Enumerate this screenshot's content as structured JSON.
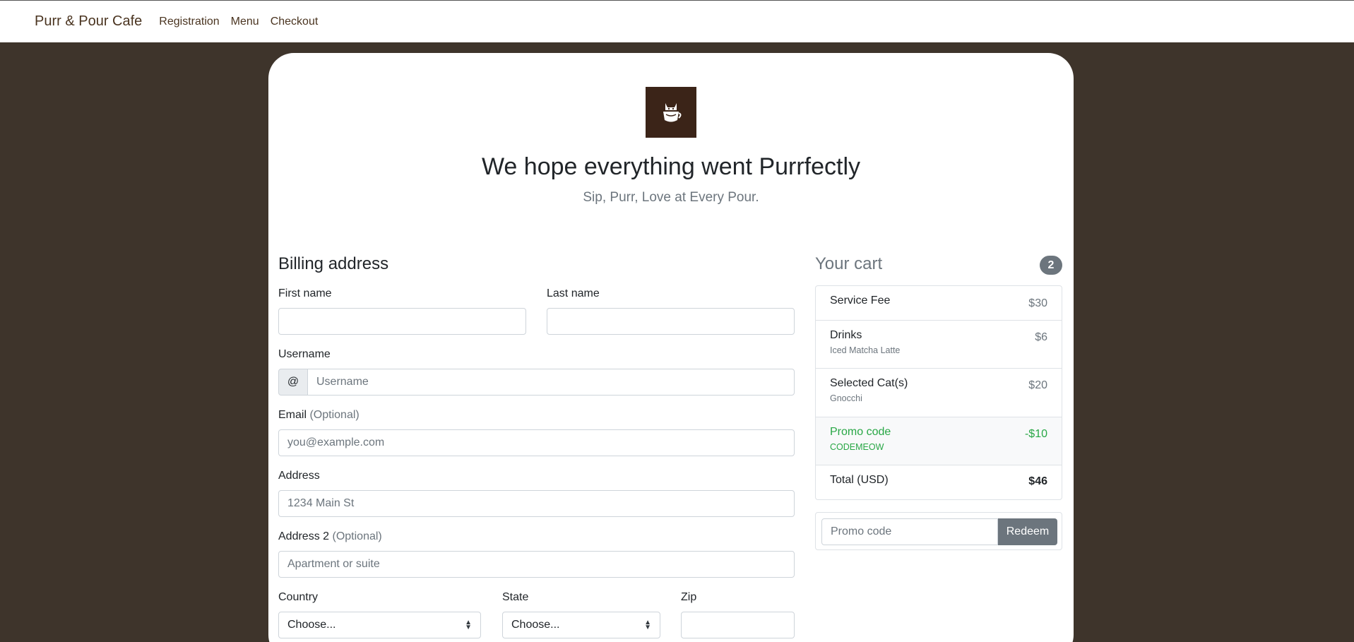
{
  "nav": {
    "brand": "Purr & Pour Cafe",
    "links": [
      "Registration",
      "Menu",
      "Checkout"
    ]
  },
  "hero": {
    "logo_icon": "cat-coffee-cup-icon",
    "title": "We hope everything went Purrfectly",
    "subtitle": "Sip, Purr, Love at Every Pour."
  },
  "billing": {
    "heading": "Billing address",
    "first_name_label": "First name",
    "first_name_value": "",
    "last_name_label": "Last name",
    "last_name_value": "",
    "username_label": "Username",
    "username_addon": "@",
    "username_placeholder": "Username",
    "email_label": "Email",
    "email_optional": "(Optional)",
    "email_placeholder": "you@example.com",
    "address_label": "Address",
    "address_placeholder": "1234 Main St",
    "address2_label": "Address 2",
    "address2_optional": "(Optional)",
    "address2_placeholder": "Apartment or suite",
    "country_label": "Country",
    "country_value": "Choose...",
    "state_label": "State",
    "state_value": "Choose...",
    "zip_label": "Zip",
    "zip_value": ""
  },
  "cart": {
    "title": "Your cart",
    "count": "2",
    "items": [
      {
        "name": "Service Fee",
        "detail": "",
        "price": "$30"
      },
      {
        "name": "Drinks",
        "detail": "Iced Matcha Latte",
        "price": "$6"
      },
      {
        "name": "Selected Cat(s)",
        "detail": "Gnocchi",
        "price": "$20"
      }
    ],
    "promo": {
      "name": "Promo code",
      "code": "CODEMEOW",
      "price": "-$10"
    },
    "total": {
      "label": "Total (USD)",
      "value": "$46"
    },
    "redeem": {
      "placeholder": "Promo code",
      "button": "Redeem"
    }
  },
  "colors": {
    "background": "#3e342b",
    "brand_text": "#4a3420",
    "logo_bg": "#3b2418",
    "promo_green": "#28a745",
    "secondary": "#6c757d"
  }
}
